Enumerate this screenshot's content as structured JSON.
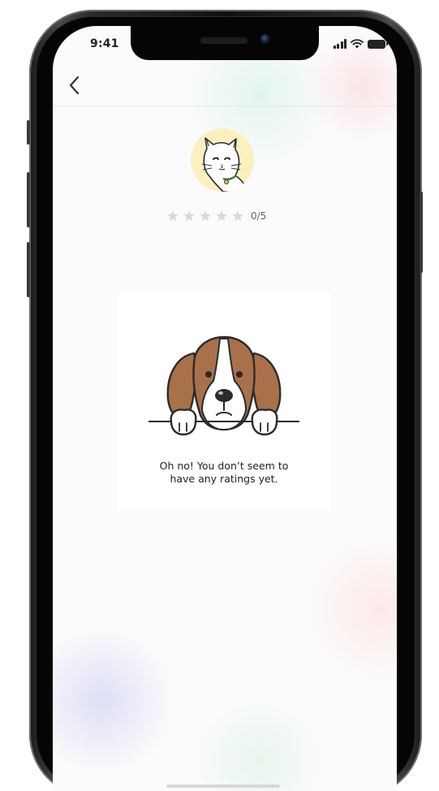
{
  "status_bar": {
    "time": "9:41"
  },
  "nav": {
    "back_icon": "chevron-left-icon"
  },
  "profile": {
    "avatar_icon": "cat-avatar-icon",
    "rating": {
      "value": 0,
      "max": 5,
      "label": "0/5",
      "star_color": "#d9d9d9"
    }
  },
  "empty_state": {
    "illustration_icon": "beagle-dog-icon",
    "message_line1": "Oh no! You don’t seem to",
    "message_line2": "have any ratings yet."
  },
  "colors": {
    "avatar_bg": "#fdf0bf",
    "dog_brown": "#a9714a",
    "text": "#222222"
  }
}
